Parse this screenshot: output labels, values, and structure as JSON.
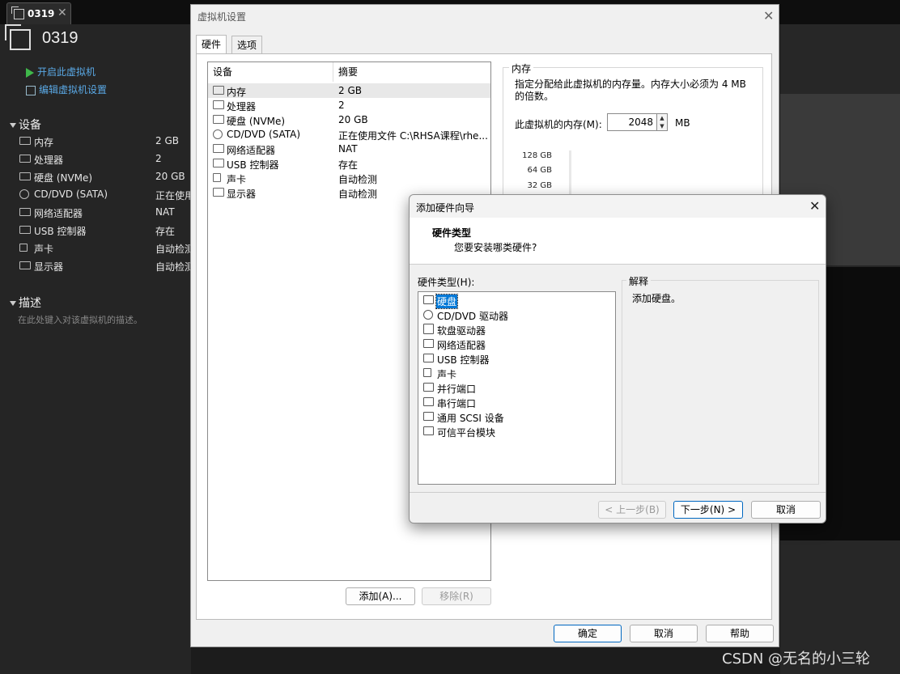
{
  "tab": {
    "label": "0319"
  },
  "vm": {
    "name": "0319",
    "actions": {
      "power_on": "开启此虚拟机",
      "edit_settings": "编辑虚拟机设置"
    },
    "devices_heading": "设备",
    "devices": [
      {
        "name": "内存",
        "value": "2 GB",
        "icon": "memory-icon"
      },
      {
        "name": "处理器",
        "value": "2",
        "icon": "cpu-icon"
      },
      {
        "name": "硬盘 (NVMe)",
        "value": "20 GB",
        "icon": "hard-disk-icon"
      },
      {
        "name": "CD/DVD (SATA)",
        "value": "正在使用",
        "icon": "cd-dvd-icon"
      },
      {
        "name": "网络适配器",
        "value": "NAT",
        "icon": "network-icon"
      },
      {
        "name": "USB 控制器",
        "value": "存在",
        "icon": "usb-icon"
      },
      {
        "name": "声卡",
        "value": "自动检测",
        "icon": "sound-icon"
      },
      {
        "name": "显示器",
        "value": "自动检测",
        "icon": "display-icon"
      }
    ],
    "description_heading": "描述",
    "description_hint": "在此处键入对该虚拟机的描述。"
  },
  "settings": {
    "title": "虚拟机设置",
    "tabs": [
      "硬件",
      "选项"
    ],
    "columns": {
      "device": "设备",
      "summary": "摘要"
    },
    "devices": [
      {
        "name": "内存",
        "summary": "2 GB",
        "icon": "memory-icon",
        "selected": true
      },
      {
        "name": "处理器",
        "summary": "2",
        "icon": "cpu-icon"
      },
      {
        "name": "硬盘 (NVMe)",
        "summary": "20 GB",
        "icon": "hard-disk-icon"
      },
      {
        "name": "CD/DVD (SATA)",
        "summary": "正在使用文件 C:\\RHSA课程\\rhe...",
        "icon": "cd-dvd-icon"
      },
      {
        "name": "网络适配器",
        "summary": "NAT",
        "icon": "network-icon"
      },
      {
        "name": "USB 控制器",
        "summary": "存在",
        "icon": "usb-icon"
      },
      {
        "name": "声卡",
        "summary": "自动检测",
        "icon": "sound-icon"
      },
      {
        "name": "显示器",
        "summary": "自动检测",
        "icon": "display-icon"
      }
    ],
    "add_button": "添加(A)...",
    "remove_button": "移除(R)",
    "memory": {
      "group_title": "内存",
      "description": "指定分配给此虚拟机的内存量。内存大小必须为 4 MB 的倍数。",
      "label": "此虚拟机的内存(M):",
      "value": "2048",
      "unit": "MB",
      "scale": [
        "128 GB",
        "64 GB",
        "32 GB"
      ]
    },
    "ok_button": "确定",
    "cancel_button": "取消",
    "help_button": "帮助"
  },
  "wizard": {
    "title": "添加硬件向导",
    "heading": "硬件类型",
    "subheading": "您要安装哪类硬件?",
    "list_label": "硬件类型(H):",
    "items": [
      {
        "name": "硬盘",
        "icon": "hard-disk-icon",
        "selected": true
      },
      {
        "name": "CD/DVD 驱动器",
        "icon": "cd-dvd-icon"
      },
      {
        "name": "软盘驱动器",
        "icon": "floppy-icon"
      },
      {
        "name": "网络适配器",
        "icon": "network-icon"
      },
      {
        "name": "USB 控制器",
        "icon": "usb-icon"
      },
      {
        "name": "声卡",
        "icon": "sound-icon"
      },
      {
        "name": "并行端口",
        "icon": "parallel-port-icon"
      },
      {
        "name": "串行端口",
        "icon": "serial-port-icon"
      },
      {
        "name": "通用 SCSI 设备",
        "icon": "scsi-icon"
      },
      {
        "name": "可信平台模块",
        "icon": "tpm-icon"
      }
    ],
    "explanation_title": "解释",
    "explanation_text": "添加硬盘。",
    "back_button": "< 上一步(B)",
    "next_button": "下一步(N) >",
    "cancel_button": "取消"
  },
  "watermark": "CSDN @无名的小三轮"
}
